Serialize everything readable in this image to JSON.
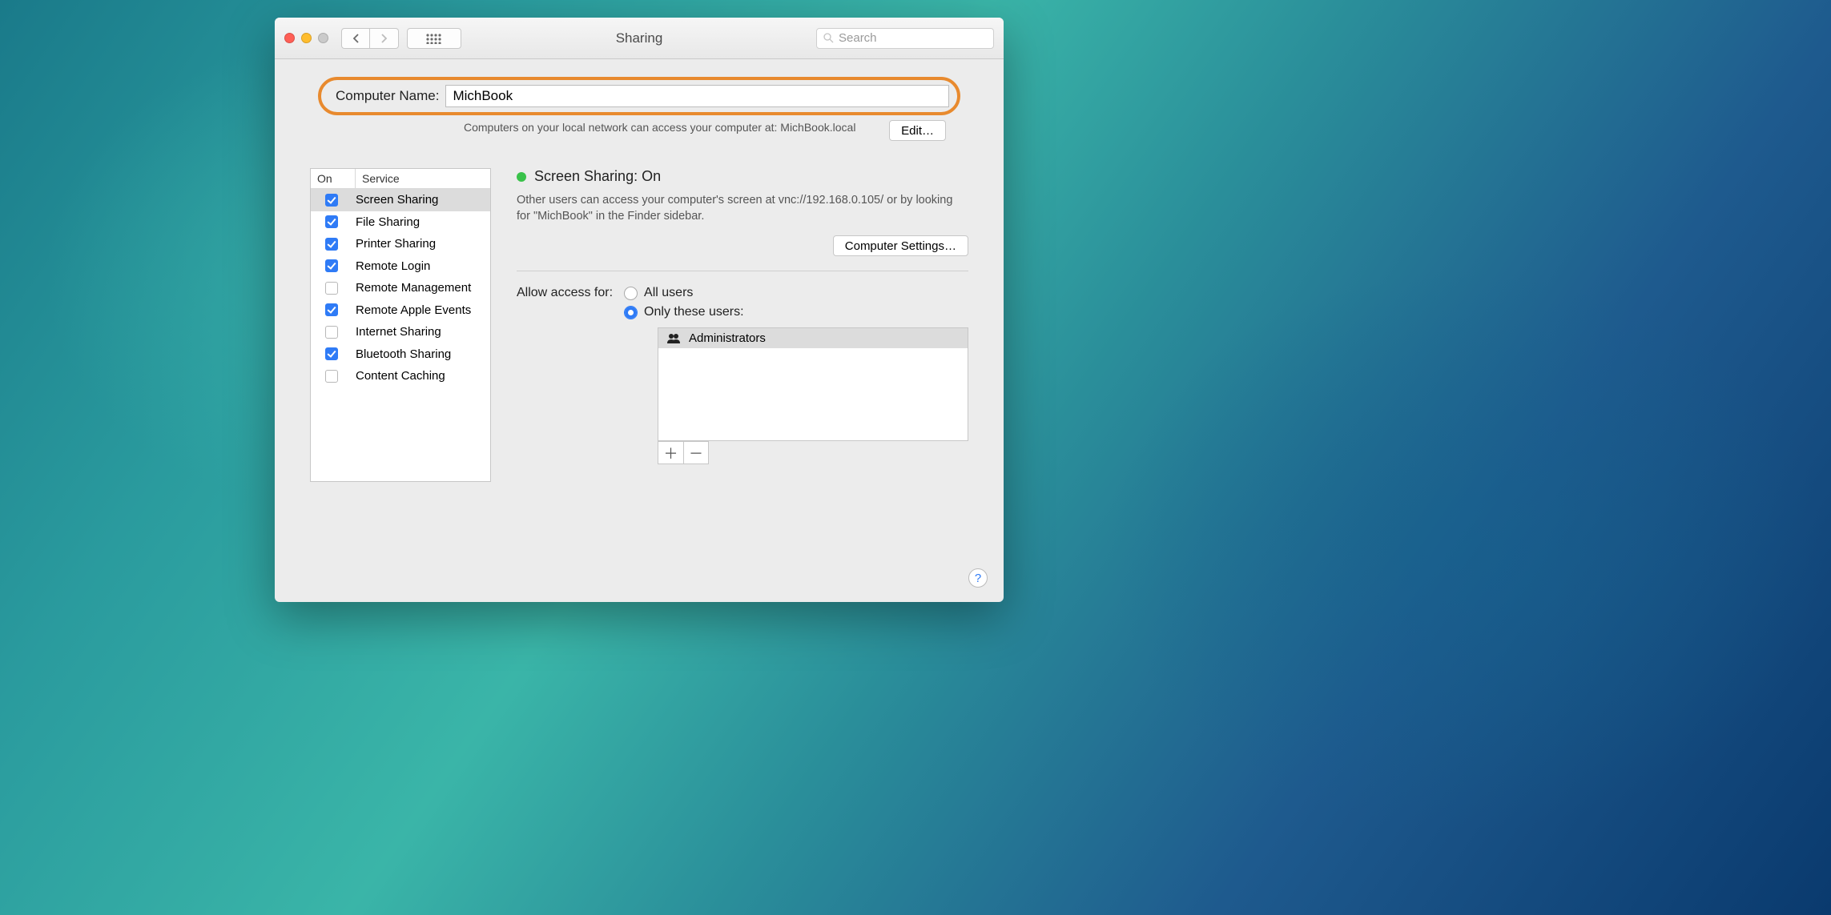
{
  "window": {
    "title": "Sharing",
    "search_placeholder": "Search"
  },
  "header": {
    "name_label": "Computer Name:",
    "name_value": "MichBook",
    "sub_text": "Computers on your local network can access your computer at: MichBook.local",
    "edit_label": "Edit…"
  },
  "table": {
    "col_on": "On",
    "col_service": "Service",
    "rows": [
      {
        "on": true,
        "label": "Screen Sharing",
        "selected": true
      },
      {
        "on": true,
        "label": "File Sharing"
      },
      {
        "on": true,
        "label": "Printer Sharing"
      },
      {
        "on": true,
        "label": "Remote Login"
      },
      {
        "on": false,
        "label": "Remote Management"
      },
      {
        "on": true,
        "label": "Remote Apple Events"
      },
      {
        "on": false,
        "label": "Internet Sharing"
      },
      {
        "on": true,
        "label": "Bluetooth Sharing"
      },
      {
        "on": false,
        "label": "Content Caching"
      }
    ]
  },
  "detail": {
    "status_title": "Screen Sharing: On",
    "description": "Other users can access your computer's screen at vnc://192.168.0.105/ or by looking for \"MichBook\" in the Finder sidebar.",
    "computer_settings_label": "Computer Settings…",
    "access_label": "Allow access for:",
    "radio_all": "All users",
    "radio_only": "Only these users:",
    "user_row": "Administrators"
  }
}
